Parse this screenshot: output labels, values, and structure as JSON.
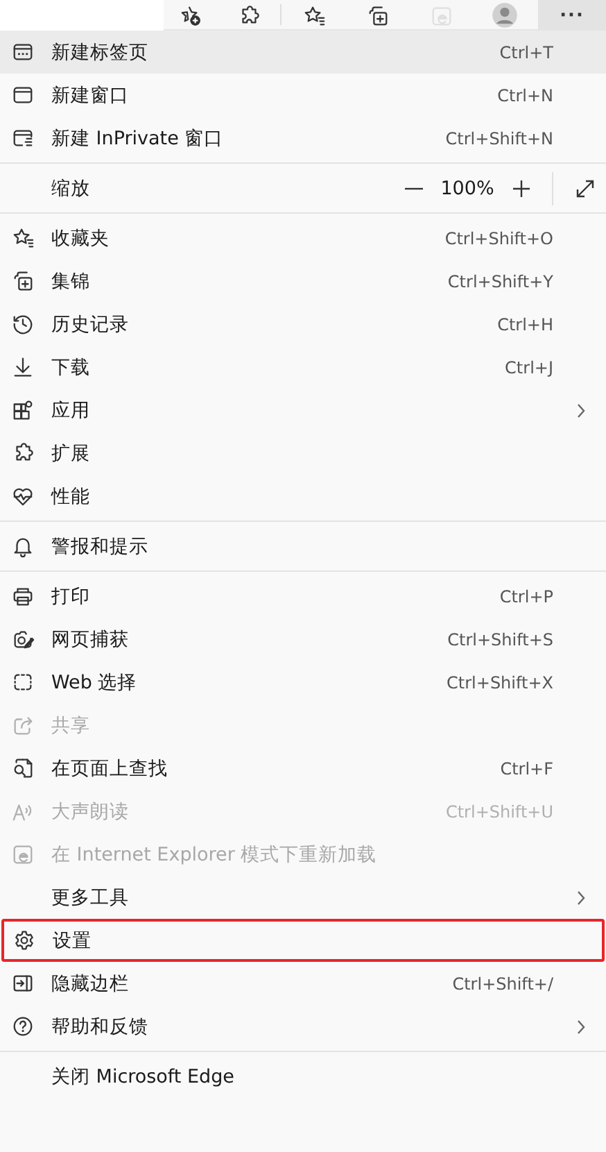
{
  "toolbar": {
    "buttons": [
      {
        "kind": "add-favorite",
        "disabled": false,
        "selected": false
      },
      {
        "kind": "extensions",
        "disabled": false,
        "selected": false
      },
      {
        "kind": "favorites",
        "disabled": false,
        "selected": false
      },
      {
        "kind": "collections",
        "disabled": false,
        "selected": false
      },
      {
        "kind": "ie-mode",
        "disabled": true,
        "selected": false
      },
      {
        "kind": "profile",
        "disabled": false,
        "selected": false
      },
      {
        "kind": "more",
        "disabled": false,
        "selected": true,
        "label": "···"
      }
    ]
  },
  "menu": {
    "items": [
      {
        "kind": "item",
        "label": "新建标签页",
        "shortcut": "Ctrl+T",
        "disabled": false,
        "highlighted": true,
        "has_submenu": false,
        "marked": false
      },
      {
        "kind": "item",
        "label": "新建窗口",
        "shortcut": "Ctrl+N",
        "disabled": false,
        "highlighted": false,
        "has_submenu": false,
        "marked": false
      },
      {
        "kind": "item",
        "label": "新建 InPrivate 窗口",
        "shortcut": "Ctrl+Shift+N",
        "disabled": false,
        "highlighted": false,
        "has_submenu": false,
        "marked": false
      },
      {
        "kind": "divider"
      },
      {
        "kind": "zoom",
        "label": "缩放",
        "value": "100%"
      },
      {
        "kind": "divider"
      },
      {
        "kind": "item",
        "label": "收藏夹",
        "shortcut": "Ctrl+Shift+O",
        "disabled": false,
        "highlighted": false,
        "has_submenu": false,
        "marked": false
      },
      {
        "kind": "item",
        "label": "集锦",
        "shortcut": "Ctrl+Shift+Y",
        "disabled": false,
        "highlighted": false,
        "has_submenu": false,
        "marked": false
      },
      {
        "kind": "item",
        "label": "历史记录",
        "shortcut": "Ctrl+H",
        "disabled": false,
        "highlighted": false,
        "has_submenu": false,
        "marked": false
      },
      {
        "kind": "item",
        "label": "下载",
        "shortcut": "Ctrl+J",
        "disabled": false,
        "highlighted": false,
        "has_submenu": false,
        "marked": false
      },
      {
        "kind": "item",
        "label": "应用",
        "disabled": false,
        "highlighted": false,
        "has_submenu": true,
        "marked": false
      },
      {
        "kind": "item",
        "label": "扩展",
        "disabled": false,
        "highlighted": false,
        "has_submenu": false,
        "marked": false
      },
      {
        "kind": "item",
        "label": "性能",
        "disabled": false,
        "highlighted": false,
        "has_submenu": false,
        "marked": false
      },
      {
        "kind": "divider"
      },
      {
        "kind": "item",
        "label": "警报和提示",
        "disabled": false,
        "highlighted": false,
        "has_submenu": false,
        "marked": false
      },
      {
        "kind": "divider"
      },
      {
        "kind": "item",
        "label": "打印",
        "shortcut": "Ctrl+P",
        "disabled": false,
        "highlighted": false,
        "has_submenu": false,
        "marked": false
      },
      {
        "kind": "item",
        "label": "网页捕获",
        "shortcut": "Ctrl+Shift+S",
        "disabled": false,
        "highlighted": false,
        "has_submenu": false,
        "marked": false
      },
      {
        "kind": "item",
        "label": "Web 选择",
        "shortcut": "Ctrl+Shift+X",
        "disabled": false,
        "highlighted": false,
        "has_submenu": false,
        "marked": false
      },
      {
        "kind": "item",
        "label": "共享",
        "disabled": true,
        "highlighted": false,
        "has_submenu": false,
        "marked": false
      },
      {
        "kind": "item",
        "label": "在页面上查找",
        "shortcut": "Ctrl+F",
        "disabled": false,
        "highlighted": false,
        "has_submenu": false,
        "marked": false
      },
      {
        "kind": "item",
        "label": "大声朗读",
        "shortcut": "Ctrl+Shift+U",
        "disabled": true,
        "highlighted": false,
        "has_submenu": false,
        "marked": false
      },
      {
        "kind": "item",
        "label": "在 Internet Explorer 模式下重新加载",
        "disabled": true,
        "highlighted": false,
        "has_submenu": false,
        "marked": false
      },
      {
        "kind": "item",
        "label": "更多工具",
        "disabled": false,
        "highlighted": false,
        "has_submenu": true,
        "marked": false
      },
      {
        "kind": "item",
        "label": "设置",
        "disabled": false,
        "highlighted": false,
        "has_submenu": false,
        "marked": true
      },
      {
        "kind": "item",
        "label": "隐藏边栏",
        "shortcut": "Ctrl+Shift+/",
        "disabled": false,
        "highlighted": false,
        "has_submenu": false,
        "marked": false
      },
      {
        "kind": "item",
        "label": "帮助和反馈",
        "disabled": false,
        "highlighted": false,
        "has_submenu": true,
        "marked": false
      },
      {
        "kind": "divider"
      },
      {
        "kind": "item",
        "label": "关闭 Microsoft Edge",
        "disabled": false,
        "highlighted": false,
        "has_submenu": false,
        "marked": false
      }
    ]
  }
}
